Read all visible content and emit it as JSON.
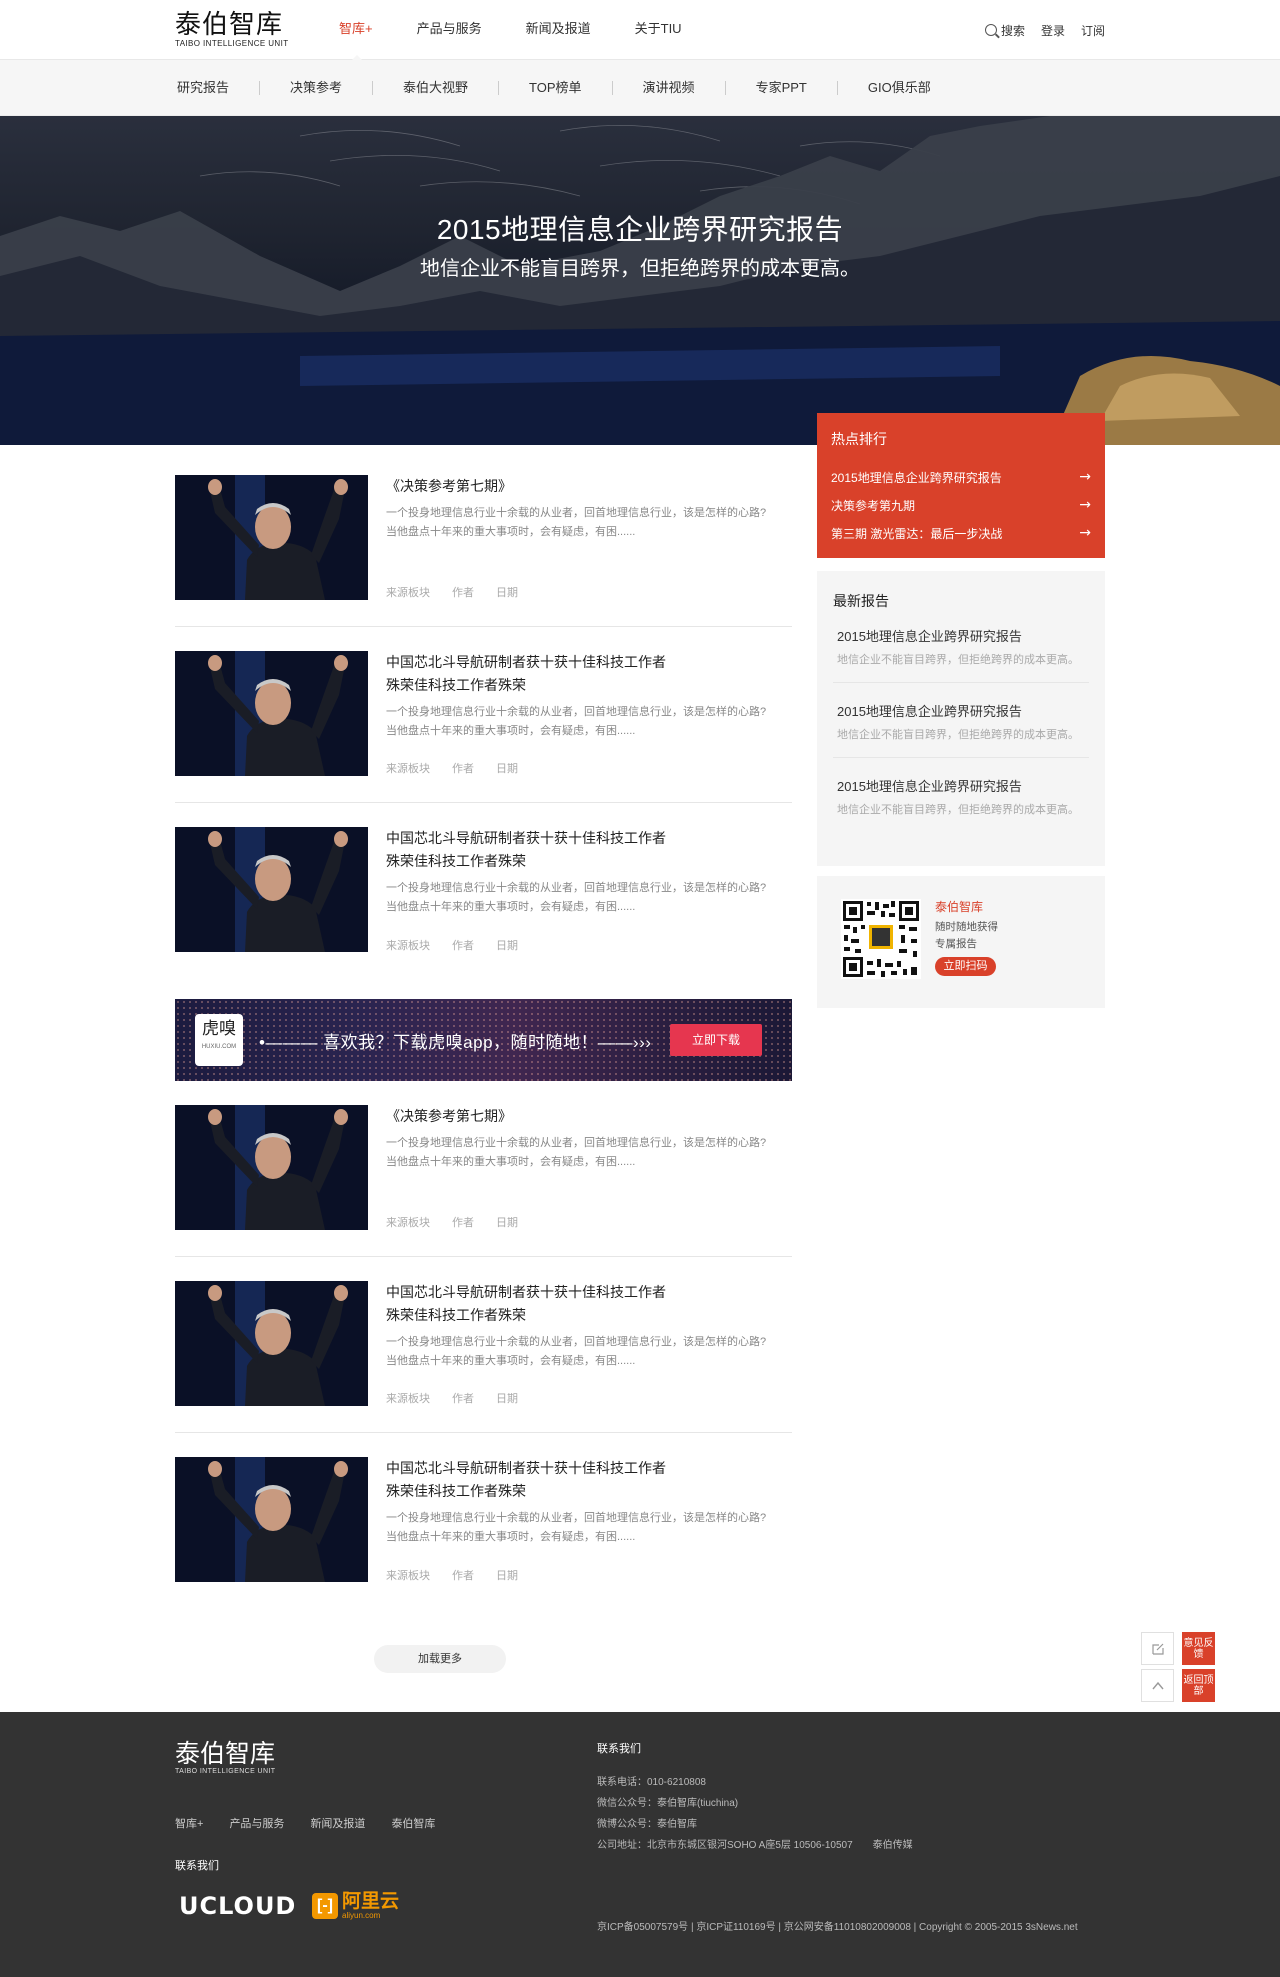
{
  "header": {
    "logo_cn": "泰伯智库",
    "logo_en": "TAIBO INTELLIGENCE UNIT",
    "nav": [
      "智库+",
      "产品与服务",
      "新闻及报道",
      "关于TIU"
    ],
    "search_label": "搜索",
    "login_label": "登录",
    "subscribe_label": "订阅"
  },
  "subnav": [
    "研究报告",
    "决策参考",
    "泰伯大视野",
    "TOP榜单",
    "演讲视频",
    "专家PPT",
    "GIO俱乐部"
  ],
  "hero": {
    "title": "2015地理信息企业跨界研究报告",
    "subtitle": "地信企业不能盲目跨界，但拒绝跨界的成本更高。"
  },
  "articles": [
    {
      "title_1": "《决策参考第七期》",
      "title_2": "",
      "desc_1": "一个投身地理信息行业十余载的从业者，回首地理信息行业，该是怎样的心路?",
      "desc_2": "当他盘点十年来的重大事项时，会有疑虑，有困......",
      "source": "来源板块",
      "author": "作者",
      "date": "日期"
    },
    {
      "title_1": "中国芯北斗导航研制者获十获十佳科技工作者",
      "title_2": "殊荣佳科技工作者殊荣",
      "desc_1": "一个投身地理信息行业十余载的从业者，回首地理信息行业，该是怎样的心路?",
      "desc_2": "当他盘点十年来的重大事项时，会有疑虑，有困......",
      "source": "来源板块",
      "author": "作者",
      "date": "日期"
    },
    {
      "title_1": "中国芯北斗导航研制者获十获十佳科技工作者",
      "title_2": "殊荣佳科技工作者殊荣",
      "desc_1": "一个投身地理信息行业十余载的从业者，回首地理信息行业，该是怎样的心路?",
      "desc_2": "当他盘点十年来的重大事项时，会有疑虑，有困......",
      "source": "来源板块",
      "author": "作者",
      "date": "日期"
    },
    {
      "title_1": "《决策参考第七期》",
      "title_2": "",
      "desc_1": "一个投身地理信息行业十余载的从业者，回首地理信息行业，该是怎样的心路?",
      "desc_2": "当他盘点十年来的重大事项时，会有疑虑，有困......",
      "source": "来源板块",
      "author": "作者",
      "date": "日期"
    },
    {
      "title_1": "中国芯北斗导航研制者获十获十佳科技工作者",
      "title_2": "殊荣佳科技工作者殊荣",
      "desc_1": "一个投身地理信息行业十余载的从业者，回首地理信息行业，该是怎样的心路?",
      "desc_2": "当他盘点十年来的重大事项时，会有疑虑，有困......",
      "source": "来源板块",
      "author": "作者",
      "date": "日期"
    },
    {
      "title_1": "中国芯北斗导航研制者获十获十佳科技工作者",
      "title_2": "殊荣佳科技工作者殊荣",
      "desc_1": "一个投身地理信息行业十余载的从业者，回首地理信息行业，该是怎样的心路?",
      "desc_2": "当他盘点十年来的重大事项时，会有疑虑，有困......",
      "source": "来源板块",
      "author": "作者",
      "date": "日期"
    }
  ],
  "ad": {
    "logo_cn": "虎嗅",
    "logo_en": "HUXIU.COM",
    "text": "•——— 喜欢我？下载虎嗅app，随时随地！——›››",
    "button": "立即下载"
  },
  "load_more": "加载更多",
  "hot": {
    "heading": "热点排行",
    "items": [
      "2015地理信息企业跨界研究报告",
      "决策参考第九期",
      "第三期 激光雷达：最后一步决战"
    ],
    "arrow": "→"
  },
  "latest": {
    "heading": "最新报告",
    "items": [
      {
        "title": "2015地理信息企业跨界研究报告",
        "desc": "地信企业不能盲目跨界，但拒绝跨界的成本更高。"
      },
      {
        "title": "2015地理信息企业跨界研究报告",
        "desc": "地信企业不能盲目跨界，但拒绝跨界的成本更高。"
      },
      {
        "title": "2015地理信息企业跨界研究报告",
        "desc": "地信企业不能盲目跨界，但拒绝跨界的成本更高。"
      }
    ]
  },
  "qr": {
    "title": "泰伯智库",
    "line1": "随时随地获得",
    "line2": "专属报告",
    "button": "立即扫码"
  },
  "floating": {
    "feedback": "意见反馈",
    "back_top": "返回顶部"
  },
  "footer": {
    "logo_cn": "泰伯智库",
    "logo_en": "TAIBO INTELLIGENCE UNIT",
    "nav": [
      "智库+",
      "产品与服务",
      "新闻及报道",
      "泰伯智库"
    ],
    "contact_label": "联系我们",
    "partners": {
      "ucloud": "UCLOUD",
      "aliyun_cn": "阿里云",
      "aliyun_en": "aliyun.com"
    },
    "contact_heading": "联系我们",
    "phone": "联系电话：010-6210808",
    "wechat": "微信公众号：泰伯智库(tiuchina)",
    "weibo": "微博公众号：泰伯智库",
    "address": "公司地址：北京市东城区银河SOHO A座5层 10506-10507　　泰伯传媒",
    "copyright": "京ICP备05007579号 | 京ICP证110169号 | 京公网安备11010802009008 | Copyright © 2005-2015 3sNews.net"
  },
  "colors": {
    "accent": "#d9412a",
    "footer_bg": "#333333",
    "ad_button": "#e6364f",
    "aliyun": "#f39800"
  }
}
